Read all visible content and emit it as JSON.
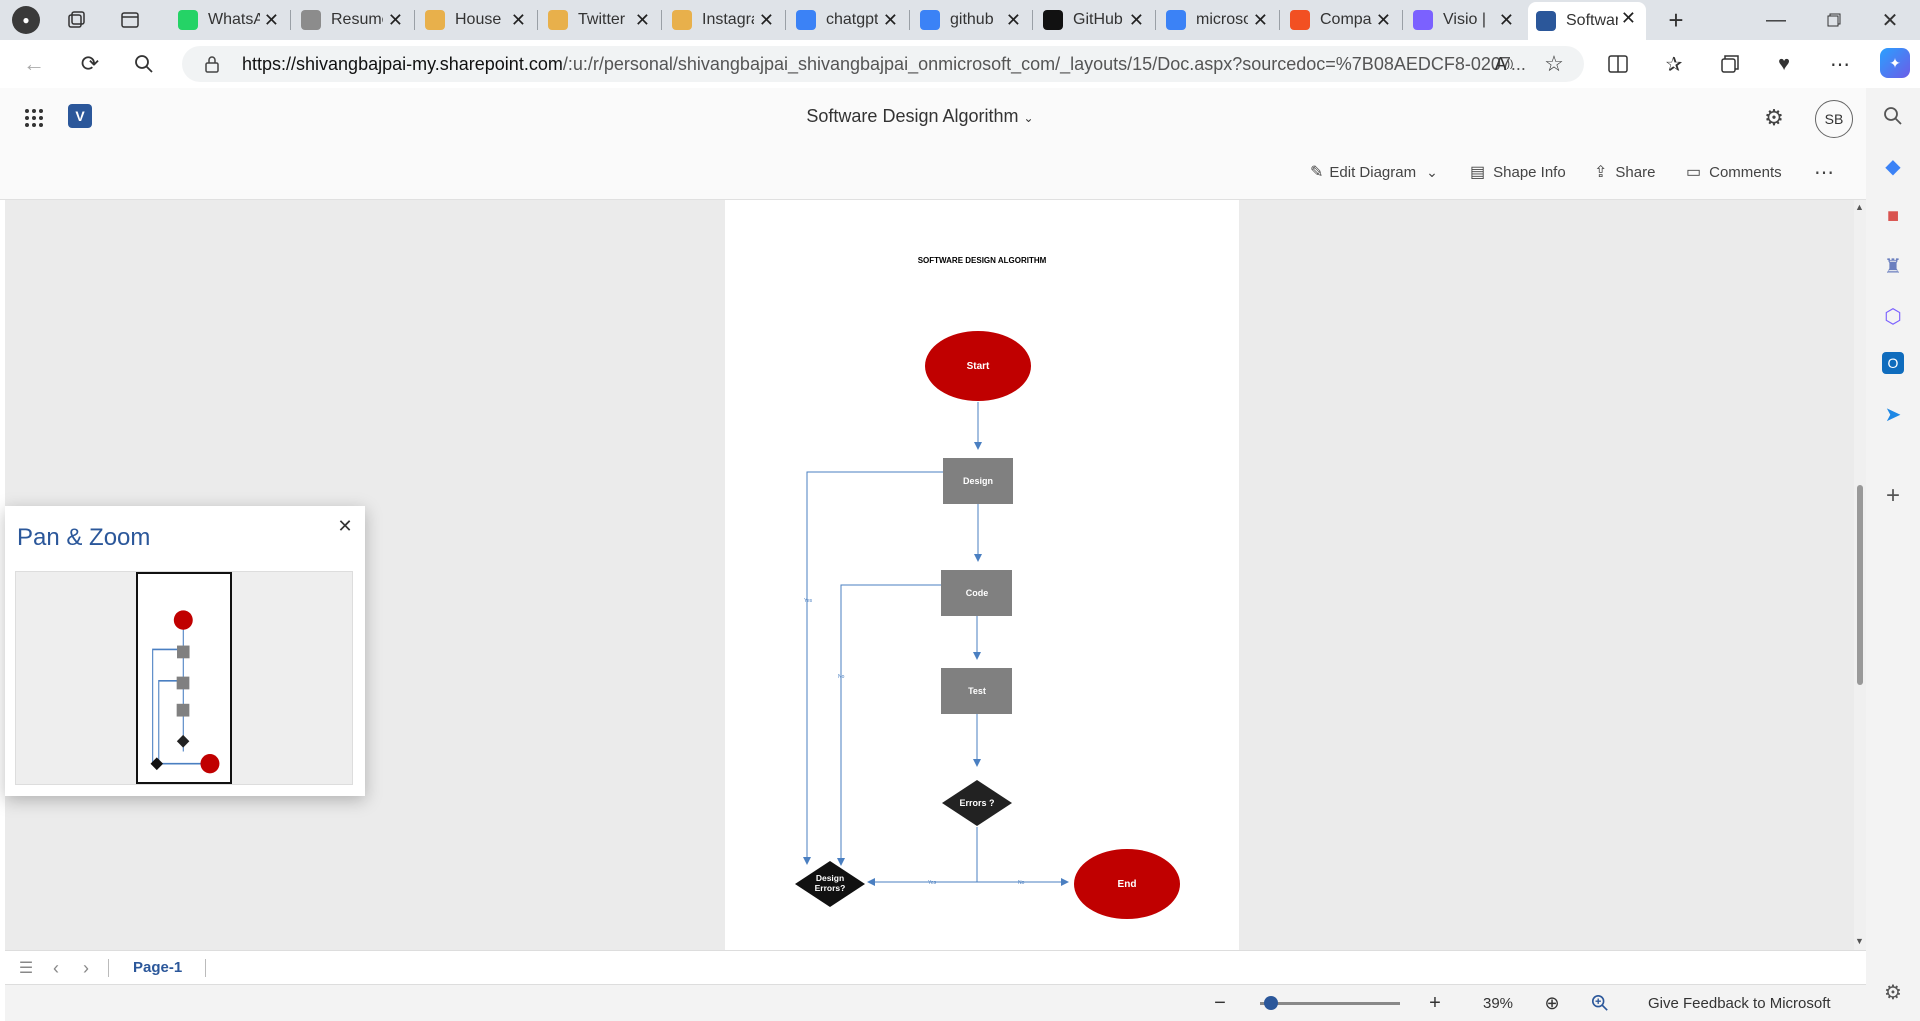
{
  "tabs": [
    {
      "title": "WhatsApp",
      "icon": "whatsapp-icon",
      "color": "#25d366"
    },
    {
      "title": "Resume",
      "icon": "resume-icon",
      "color": "#8c8c8c"
    },
    {
      "title": "House",
      "icon": "copilot-icon",
      "color": "#e8b04b"
    },
    {
      "title": "Twitter",
      "icon": "copilot-icon",
      "color": "#e8b04b"
    },
    {
      "title": "Instagram",
      "icon": "copilot-icon",
      "color": "#e8b04b"
    },
    {
      "title": "chatgpt",
      "icon": "search-icon",
      "color": "#3b82f6"
    },
    {
      "title": "github",
      "icon": "search-icon",
      "color": "#3b82f6"
    },
    {
      "title": "GitHub",
      "icon": "github-icon",
      "color": "#111111"
    },
    {
      "title": "microsoft",
      "icon": "search-icon",
      "color": "#3b82f6"
    },
    {
      "title": "Company",
      "icon": "microsoft-icon",
      "color": "#f25022"
    },
    {
      "title": "Visio |",
      "icon": "copilot-icon",
      "color": "#7b61ff"
    },
    {
      "title": "Software",
      "icon": "visio-icon",
      "color": "#2b579a",
      "active": true
    }
  ],
  "browser": {
    "url_host": "https://shivangbajpai-my.sharepoint.com",
    "url_path": "/:u:/r/personal/shivangbajpai_shivangbajpai_onmicrosoft_com/_layouts/15/Doc.aspx?sourcedoc=%7B08AEDCF8-0207..."
  },
  "header": {
    "doc_title": "Software Design Algorithm",
    "avatar": "SB",
    "commands": {
      "edit": "Edit Diagram",
      "shape_info": "Shape Info",
      "share": "Share",
      "comments": "Comments"
    }
  },
  "diagram": {
    "title": "SOFTWARE DESIGN ALGORITHM",
    "nodes": {
      "start": "Start",
      "design": "Design",
      "code": "Code",
      "test": "Test",
      "errors": "Errors ?",
      "design_errors_1": "Design",
      "design_errors_2": "Errors?",
      "end": "End"
    },
    "edge_labels": {
      "yes": "Yes",
      "no": "No"
    }
  },
  "pan_zoom": {
    "title": "Pan & Zoom"
  },
  "pagebar": {
    "page": "Page-1"
  },
  "status": {
    "zoom": "39%",
    "zoom_fraction": 0.03,
    "feedback": "Give Feedback to Microsoft"
  },
  "colors": {
    "accent": "#2b579a",
    "node_red": "#c00000",
    "node_gray": "#808080",
    "connector": "#4a7fc1"
  }
}
